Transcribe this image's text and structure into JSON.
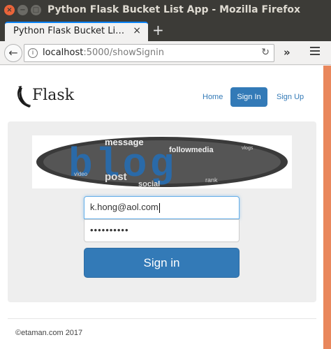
{
  "window": {
    "title": "Python Flask Bucket List App - Mozilla Firefox",
    "close_glyph": "×",
    "minimize_glyph": "−",
    "maximize_glyph": "□"
  },
  "tabs": [
    {
      "label": "Python Flask Bucket Li…",
      "close_glyph": "×"
    }
  ],
  "new_tab_glyph": "+",
  "nav": {
    "back_glyph": "←",
    "info_glyph": "i",
    "url_host": "localhost",
    "url_rest": ":5000/showSignin",
    "reload_glyph": "↻",
    "overflow_glyph": "»"
  },
  "page": {
    "brand": "Flask",
    "links": {
      "home": "Home",
      "signin": "Sign In",
      "signup": "Sign Up"
    },
    "form": {
      "email_value": "k.hong@aol.com",
      "password_value": "••••••••••",
      "submit_label": "Sign in"
    },
    "blog_image": {
      "main_word": "blog",
      "word_cloud": [
        "message",
        "followmedia",
        "post",
        "social",
        "rank",
        "video",
        "vlogs"
      ]
    },
    "footer": "©etaman.com 2017"
  },
  "colors": {
    "titlebar": "#3c3b37",
    "primary": "#337ab7",
    "scroll_strip": "#e9875c",
    "jumbotron": "#eeeeee",
    "blog_blue": "#2a6aa8"
  },
  "icons": {
    "close": "close-icon",
    "back": "back-arrow-icon",
    "info": "info-icon",
    "reload": "reload-icon",
    "overflow": "chevron-double-right-icon",
    "menu": "hamburger-menu-icon",
    "logo": "flask-horn-icon"
  }
}
